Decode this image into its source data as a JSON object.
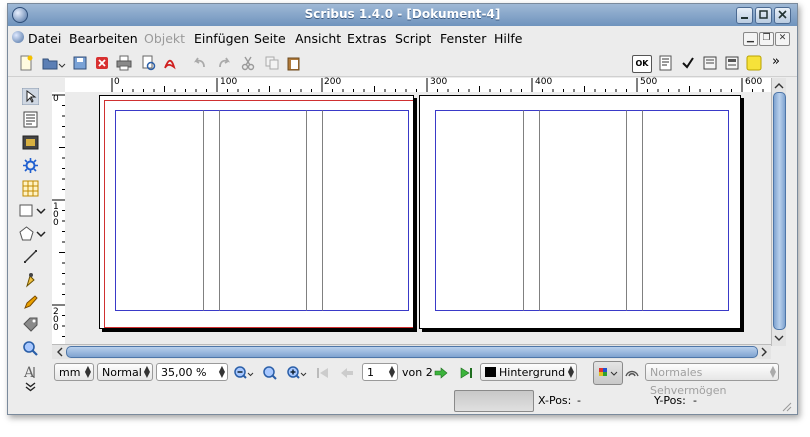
{
  "window": {
    "title": "Scribus 1.4.0 - [Dokument-4]"
  },
  "menu": [
    {
      "label": "Datei",
      "enabled": true
    },
    {
      "label": "Bearbeiten",
      "enabled": true
    },
    {
      "label": "Objekt",
      "enabled": false
    },
    {
      "label": "Einfügen",
      "enabled": true
    },
    {
      "label": "Seite",
      "enabled": true
    },
    {
      "label": "Ansicht",
      "enabled": true
    },
    {
      "label": "Extras",
      "enabled": true
    },
    {
      "label": "Script",
      "enabled": true
    },
    {
      "label": "Fenster",
      "enabled": true
    },
    {
      "label": "Hilfe",
      "enabled": true
    }
  ],
  "toolbar": {
    "ok_label": "OK",
    "overflow": "»"
  },
  "ruler": {
    "h_labels": [
      "0",
      "100",
      "200",
      "300",
      "400",
      "500",
      "600"
    ],
    "v_labels": [
      "0",
      "100",
      "200"
    ]
  },
  "statusbar": {
    "unit": "mm",
    "mode": "Normal",
    "zoom": "35,00 %",
    "page_current": "1",
    "page_total_label": "von 2",
    "layer": "Hintergrund",
    "vision": "Normales Sehvermögen"
  },
  "info": {
    "xpos_label": "X-Pos:",
    "xpos_value": "-",
    "ypos_label": "Y-Pos:",
    "ypos_value": "-"
  },
  "colors": {
    "margin_guide": "#3a3ac8",
    "bleed_guide": "#d03030",
    "column_guide": "#808080",
    "accent": "#6f93bd"
  }
}
